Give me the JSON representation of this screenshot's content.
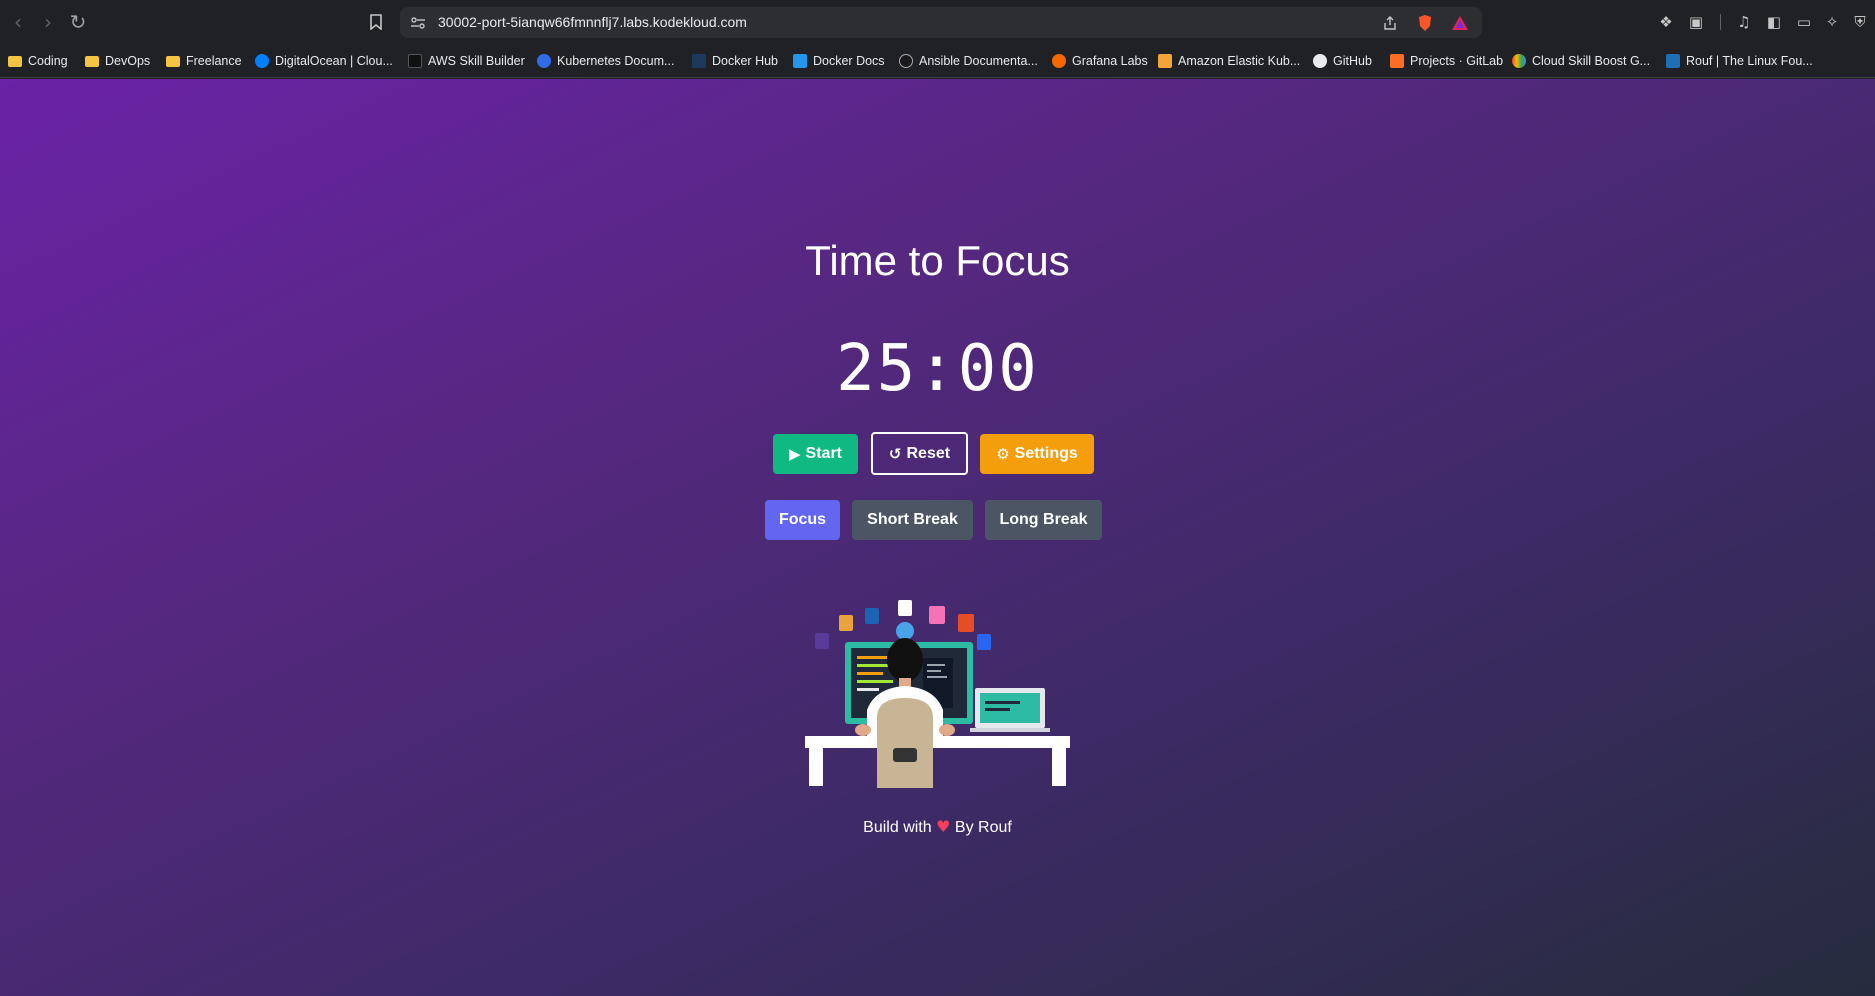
{
  "browser": {
    "url": "30002-port-5ianqw66fmnnflj7.labs.kodekloud.com",
    "bookmarks": [
      {
        "label": "Coding",
        "icon": "folder-icon"
      },
      {
        "label": "DevOps",
        "icon": "folder-icon"
      },
      {
        "label": "Freelance",
        "icon": "folder-icon"
      },
      {
        "label": "DigitalOcean | Clou...",
        "icon": "digitalocean-icon"
      },
      {
        "label": "AWS Skill Builder",
        "icon": "aws-icon"
      },
      {
        "label": "Kubernetes Docum...",
        "icon": "kubernetes-icon"
      },
      {
        "label": "Docker Hub",
        "icon": "docker-icon"
      },
      {
        "label": "Docker Docs",
        "icon": "docker-icon"
      },
      {
        "label": "Ansible Documenta...",
        "icon": "ansible-icon"
      },
      {
        "label": "Grafana Labs",
        "icon": "grafana-icon"
      },
      {
        "label": "Amazon Elastic Kub...",
        "icon": "aws-eks-icon"
      },
      {
        "label": "GitHub",
        "icon": "github-icon"
      },
      {
        "label": "Projects · GitLab",
        "icon": "gitlab-icon"
      },
      {
        "label": "Cloud Skill Boost G...",
        "icon": "google-cloud-icon"
      },
      {
        "label": "Rouf | The Linux Fou...",
        "icon": "linux-foundation-icon"
      }
    ]
  },
  "app": {
    "title": "Time to Focus",
    "timer": "25:00",
    "controls": {
      "start": "Start",
      "reset": "Reset",
      "settings": "Settings"
    },
    "modes": {
      "focus": "Focus",
      "short_break": "Short Break",
      "long_break": "Long Break",
      "active": "Focus"
    },
    "footer": {
      "prefix": "Build with",
      "suffix": "By Rouf"
    }
  },
  "colors": {
    "start": "#10b981",
    "settings": "#f59e0b",
    "focus_active": "#6366f1",
    "mode_inactive": "#4b5563",
    "heart": "#f43f5e"
  }
}
